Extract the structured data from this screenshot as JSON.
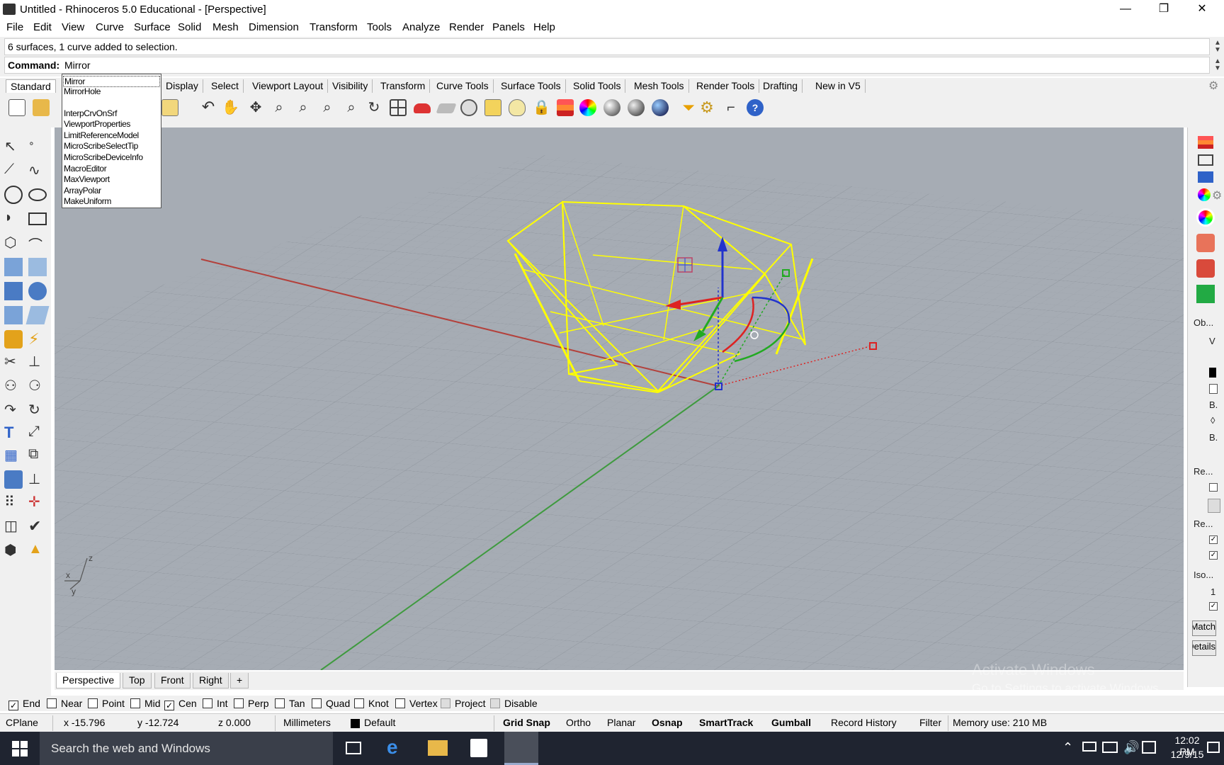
{
  "window": {
    "title": "Untitled - Rhinoceros 5.0 Educational - [Perspective]",
    "minimize_glyph": "—",
    "restore_glyph": "❐",
    "close_glyph": "✕"
  },
  "menu": [
    "File",
    "Edit",
    "View",
    "Curve",
    "Surface",
    "Solid",
    "Mesh",
    "Dimension",
    "Transform",
    "Tools",
    "Analyze",
    "Render",
    "Panels",
    "Help"
  ],
  "command": {
    "history": "6 surfaces, 1 curve added to selection.",
    "label": "Command:",
    "value": "Mirror"
  },
  "autocomplete": {
    "items": [
      "Mirror",
      "MirrorHole",
      "",
      "InterpCrvOnSrf",
      "ViewportProperties",
      "LimitReferenceModel",
      "MicroScribeSelectTip",
      "MicroScribeDeviceInfo",
      "MacroEditor",
      "MaxViewport",
      "ArrayPolar",
      "MakeUniform"
    ],
    "selected": "Mirror"
  },
  "toolbar_tabs": [
    "Standard",
    "Display",
    "Select",
    "Viewport Layout",
    "Visibility",
    "Transform",
    "Curve Tools",
    "Surface Tools",
    "Solid Tools",
    "Mesh Tools",
    "Render Tools",
    "Drafting",
    "New in V5"
  ],
  "toolbar_tabs_active": "Standard",
  "toolbar_icons": [
    "new-icon",
    "open-icon",
    "save-icon",
    "print-icon",
    "cut-icon",
    "copy-icon",
    "paste-icon",
    "undo-icon",
    "pan-icon",
    "rotate-view-icon",
    "zoom-icon",
    "zoom-window-icon",
    "zoom-extents-icon",
    "zoom-selected-icon",
    "rotate-icon",
    "viewport-layout-icon",
    "car-icon",
    "plane-icon",
    "cplane-icon",
    "named-view-icon",
    "light-icon",
    "lock-icon",
    "layer-icon",
    "color-wheel-icon",
    "shade-icon",
    "render-icon",
    "material-sphere-icon",
    "filter-icon",
    "gear-options-icon",
    "dimension-icon",
    "help-icon"
  ],
  "viewport": {
    "axis_labels": {
      "x": "x",
      "y": "y",
      "z": "z"
    }
  },
  "viewport_tabs": [
    "Perspective",
    "Top",
    "Front",
    "Right"
  ],
  "viewport_tab_active": "Perspective",
  "viewport_tab_add": "+",
  "right_panel": {
    "labels": [
      "Ob...",
      "V",
      "B.",
      "B.",
      "Re...",
      "Re...",
      "Iso...",
      "1"
    ],
    "diamond": "◊",
    "buttons": [
      "Match",
      "Details"
    ]
  },
  "osnaps": [
    {
      "label": "End",
      "checked": true
    },
    {
      "label": "Near",
      "checked": false
    },
    {
      "label": "Point",
      "checked": false
    },
    {
      "label": "Mid",
      "checked": false
    },
    {
      "label": "Cen",
      "checked": true
    },
    {
      "label": "Int",
      "checked": false
    },
    {
      "label": "Perp",
      "checked": false
    },
    {
      "label": "Tan",
      "checked": false
    },
    {
      "label": "Quad",
      "checked": false
    },
    {
      "label": "Knot",
      "checked": false
    },
    {
      "label": "Vertex",
      "checked": false
    },
    {
      "label": "Project",
      "checked": false
    },
    {
      "label": "Disable",
      "checked": false
    }
  ],
  "status": {
    "cplane": "CPlane",
    "x": "x -15.796",
    "y": "y -12.724",
    "z": "z 0.000",
    "units": "Millimeters",
    "layer": "Default",
    "toggles": [
      "Grid Snap",
      "Ortho",
      "Planar",
      "Osnap",
      "SmartTrack",
      "Gumball",
      "Record History",
      "Filter"
    ],
    "memory": "Memory use: 210 MB"
  },
  "activate_windows": {
    "title": "Activate Windows",
    "subtitle": "Go to Settings to activate Windows."
  },
  "taskbar": {
    "search_placeholder": "Search the web and Windows",
    "time": "12:02 PM",
    "date": "12/9/15"
  }
}
